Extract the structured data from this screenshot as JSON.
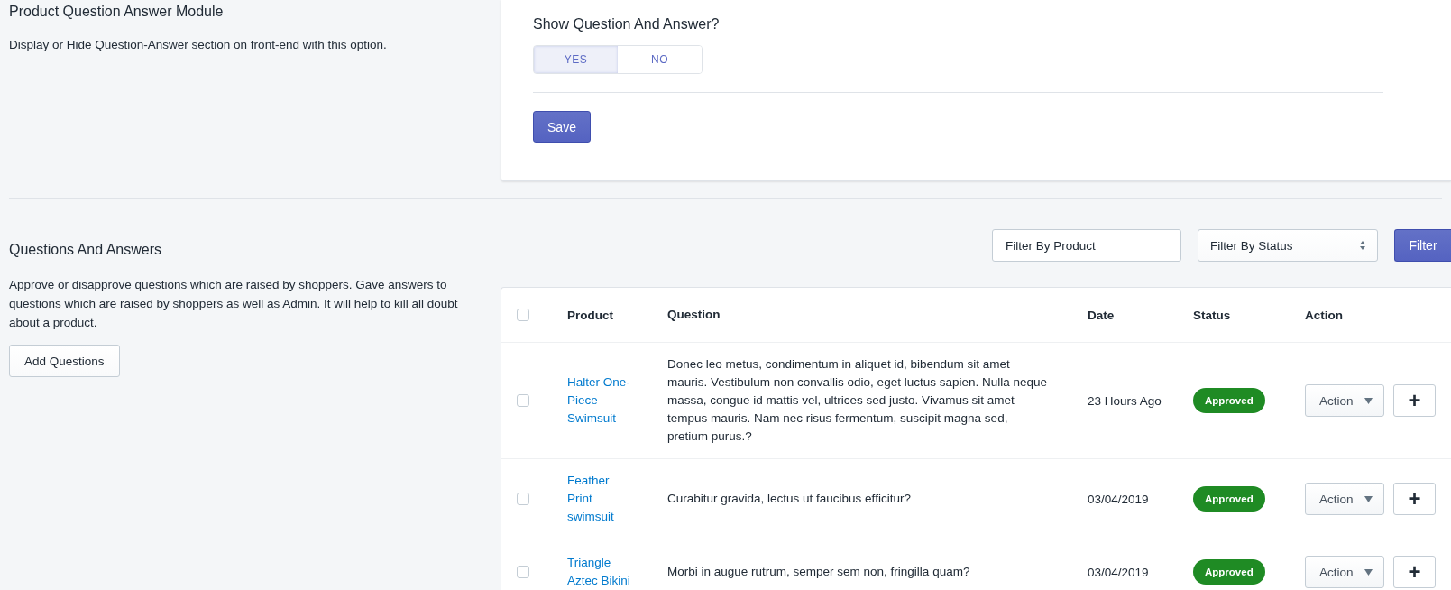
{
  "module_section": {
    "title": "Product Question Answer Module",
    "description": "Display or Hide Question-Answer section on front-end with this option."
  },
  "settings_card": {
    "question": "Show Question And Answer?",
    "options": [
      {
        "label": "YES",
        "selected": true
      },
      {
        "label": "NO",
        "selected": false
      }
    ],
    "save_button": "Save"
  },
  "qa_section": {
    "title": "Questions And Answers",
    "description": "Approve or disapprove questions which are raised by shoppers. Gave answers to questions which are raised by shoppers as well as Admin. It will help to kill all doubt about a product.",
    "add_button": "Add Questions"
  },
  "filters": {
    "product": {
      "placeholder": "Filter By Product"
    },
    "status": {
      "value": "Filter By Status"
    },
    "button": "Filter"
  },
  "table": {
    "select_all": {
      "checked": false
    },
    "columns": [
      "Product",
      "Question",
      "Date",
      "Status",
      "Action"
    ],
    "rows": [
      {
        "checked": false,
        "product": "Halter One-Piece Swimsuit",
        "question": "Donec leo metus, condimentum in aliquet id, bibendum sit amet mauris. Vestibulum non convallis odio, eget luctus sapien. Nulla neque massa, congue id mattis vel, ultrices sed justo. Vivamus sit amet tempus mauris. Nam nec risus fermentum, suscipit magna sed, pretium purus.?",
        "date": "23 Hours Ago",
        "status": "Approved",
        "action": "Action",
        "add": "+"
      },
      {
        "checked": false,
        "product": "Feather Print swimsuit",
        "question": "Curabitur gravida, lectus ut faucibus efficitur?",
        "date": "03/04/2019",
        "status": "Approved",
        "action": "Action",
        "add": "+"
      },
      {
        "checked": false,
        "product": "Triangle Aztec Bikini",
        "question": "Morbi in augue rutrum, semper sem non, fringilla quam?",
        "date": "03/04/2019",
        "status": "Approved",
        "action": "Action",
        "add": "+"
      }
    ]
  }
}
